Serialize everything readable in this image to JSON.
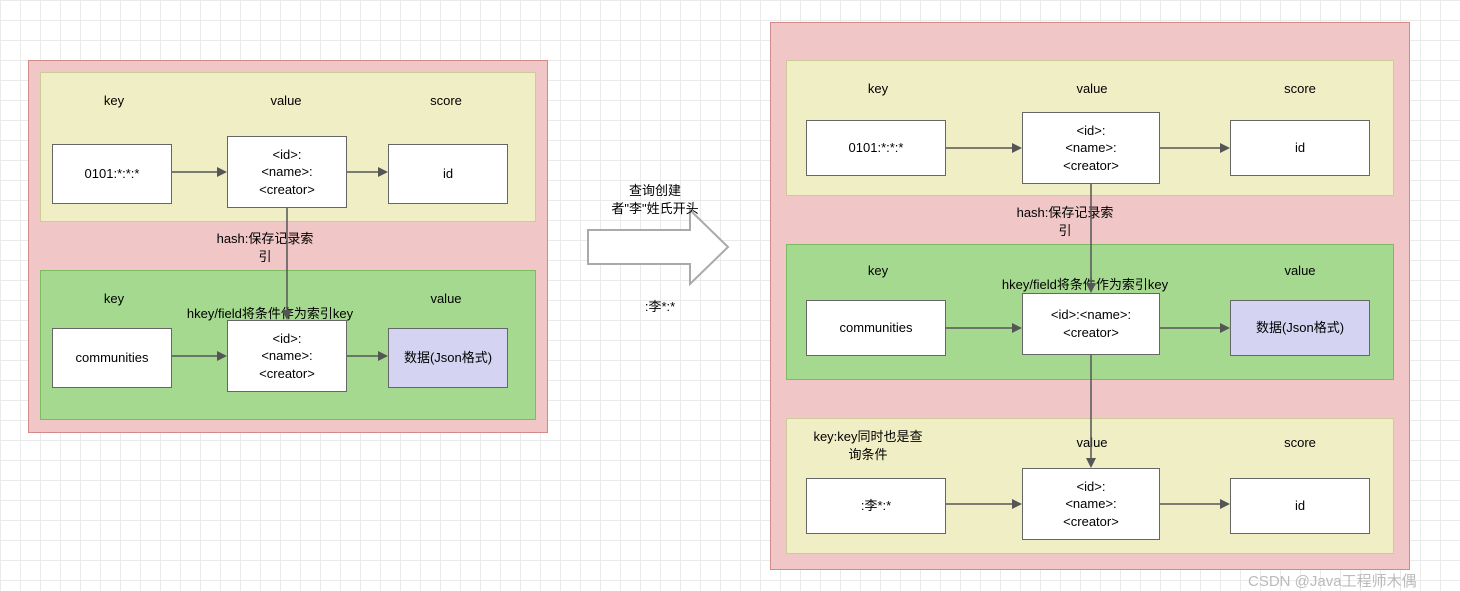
{
  "left": {
    "top": {
      "h_key": "key",
      "h_value": "value",
      "h_score": "score",
      "key": "0101:*:*:*",
      "value": "<id>:\n<name>:\n<creator>",
      "score": "id"
    },
    "mid_label": "hash:保存记录索\n引",
    "bottom": {
      "h_key": "key",
      "h_mid": "hkey/field将条件作为索引key",
      "h_value": "value",
      "key": "communities",
      "value": "<id>:\n<name>:\n<creator>",
      "data": "数据(Json格式)"
    }
  },
  "center": {
    "line1": "查询创建\n者\"李\"姓氏开头",
    "line2": ":李*:*"
  },
  "right": {
    "top": {
      "h_key": "key",
      "h_value": "value",
      "h_score": "score",
      "key": "0101:*:*:*",
      "value": "<id>:\n<name>:\n<creator>",
      "score": "id"
    },
    "mid_label": "hash:保存记录索\n引",
    "middle": {
      "h_key": "key",
      "h_mid": "hkey/field将条件作为索引key",
      "h_value": "value",
      "key": "communities",
      "value": "<id>:<name>:\n<creator>",
      "data": "数据(Json格式)"
    },
    "bottom": {
      "h_key": "key:key同时也是查\n询条件",
      "h_value": "value",
      "h_score": "score",
      "key": ":李*:*",
      "value": "<id>:\n<name>:\n<creator>",
      "score": "id"
    }
  },
  "watermark": "CSDN @Java工程师木偶"
}
